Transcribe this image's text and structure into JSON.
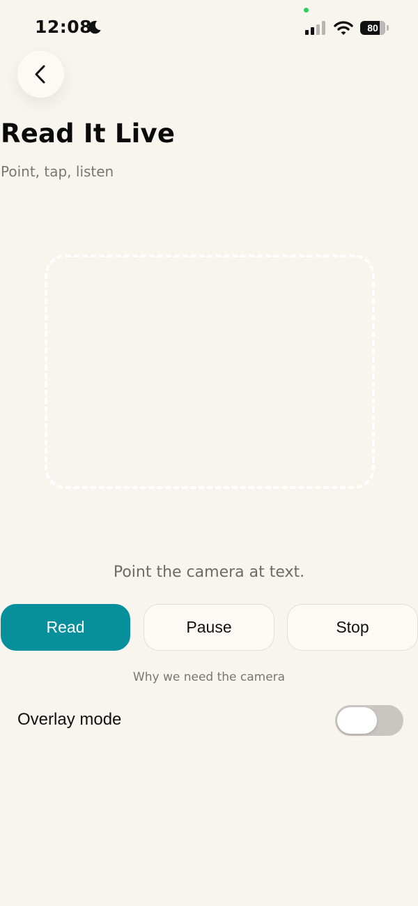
{
  "status_bar": {
    "time": "12:08",
    "battery_level": "80",
    "battery_percent": 80,
    "camera_indicator_color": "#2fcf5f"
  },
  "nav": {
    "back_icon": "chevron-left-icon"
  },
  "header": {
    "title": "Read It Live",
    "subtitle": "Point, tap, listen"
  },
  "camera": {
    "hint": "Point the camera at text."
  },
  "controls": {
    "read_label": "Read",
    "pause_label": "Pause",
    "stop_label": "Stop",
    "accent_color": "#078f9c"
  },
  "permission_link": "Why we need the camera",
  "overlay": {
    "label": "Overlay mode",
    "enabled": false
  }
}
